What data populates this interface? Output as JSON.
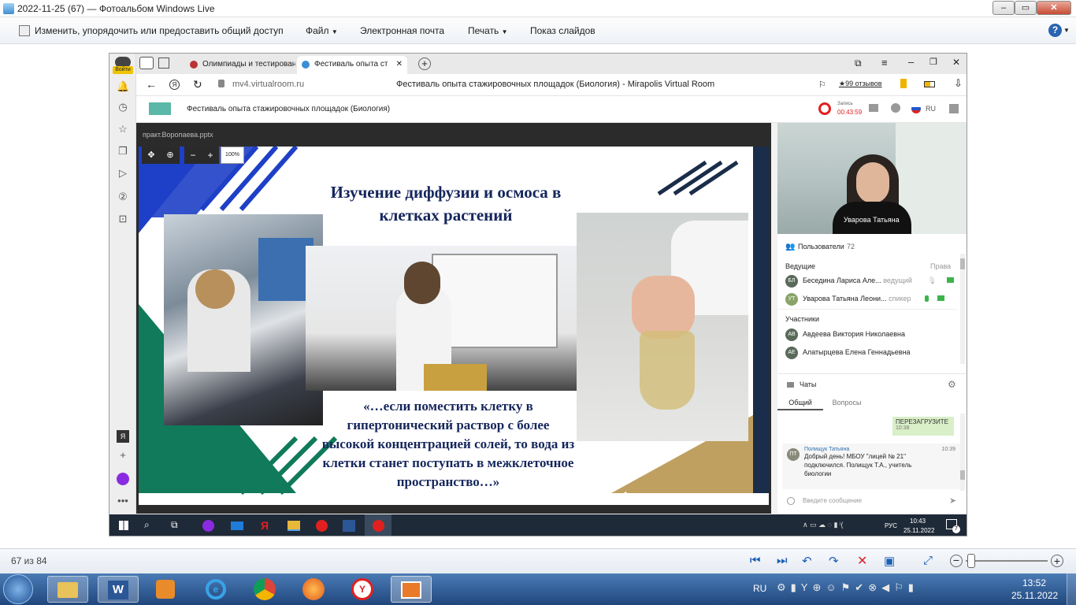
{
  "window": {
    "title": "2022-11-25 (67) — Фотоальбом Windows Live"
  },
  "menubar": {
    "items": [
      {
        "label": "Изменить, упорядочить или предоставить общий доступ"
      },
      {
        "label": "Файл"
      },
      {
        "label": "Электронная почта"
      },
      {
        "label": "Печать"
      },
      {
        "label": "Показ слайдов"
      }
    ],
    "help": "?"
  },
  "browser": {
    "login_label": "Войти",
    "tabs": [
      {
        "label": "Олимпиады и тестирован"
      },
      {
        "label": "Фестиваль опыта ст"
      }
    ],
    "address": "mv4.virtualroom.ru",
    "page_title": "Фестиваль опыта стажировочных площадок (Биология) - Mirapolis Virtual Room",
    "reviews": "★99 отзывов"
  },
  "room": {
    "title": "Фестиваль опыта стажировочных площадок (Биология)",
    "record_label": "Запись",
    "record_time": "00:43:59",
    "lang": "RU",
    "filename": "практ.Воропаева.pptx",
    "zoom": "100%"
  },
  "slide": {
    "title_line1": "Изучение диффузии и осмоса в",
    "title_line2": "клетках растений",
    "quote_line1": "«…если поместить клетку в",
    "quote_line2": "гипертонический раствор с более",
    "quote_line3": "высокой концентрацией солей, то вода из",
    "quote_line4": "клетки станет поступать в межклеточное",
    "quote_line5": "пространство…»"
  },
  "video": {
    "speaker": "Уварова Татьяна"
  },
  "users": {
    "header": "Пользователи",
    "count": "72",
    "hosts_label": "Ведущие",
    "rights_label": "Права",
    "hosts": [
      {
        "initials": "БЛ",
        "name": "Беседина Лариса Але...",
        "role": "ведущий"
      },
      {
        "initials": "УТ",
        "name": "Уварова Татьяна Леони...",
        "role": "спикер"
      }
    ],
    "participants_label": "Участники",
    "participants": [
      {
        "initials": "АВ",
        "name": "Авдеева Виктория Николаевна"
      },
      {
        "initials": "АЕ",
        "name": "Алатырцева Елена Геннадьевна"
      }
    ]
  },
  "chats": {
    "header": "Чаты",
    "tab_general": "Общий",
    "tab_questions": "Вопросы",
    "messages": [
      {
        "text": "ПЕРЕЗАГРУЗИТЕ",
        "time": "10:38"
      },
      {
        "initials": "ПТ",
        "author": "Полищук Татьяна",
        "time": "10:39",
        "text1": "Добрый день! МБОУ \"лицей № 21\"",
        "text2": "подключился. Полищук Т.А., учитель",
        "text3": "биологии"
      }
    ],
    "input_placeholder": "Введите сообщение"
  },
  "inner_taskbar": {
    "lang": "РУС",
    "time": "10:43",
    "date": "25.11.2022",
    "notif": "7"
  },
  "statusbar": {
    "counter": "67 из 84"
  },
  "taskbar": {
    "lang": "RU",
    "time": "13:52",
    "date": "25.11.2022"
  }
}
